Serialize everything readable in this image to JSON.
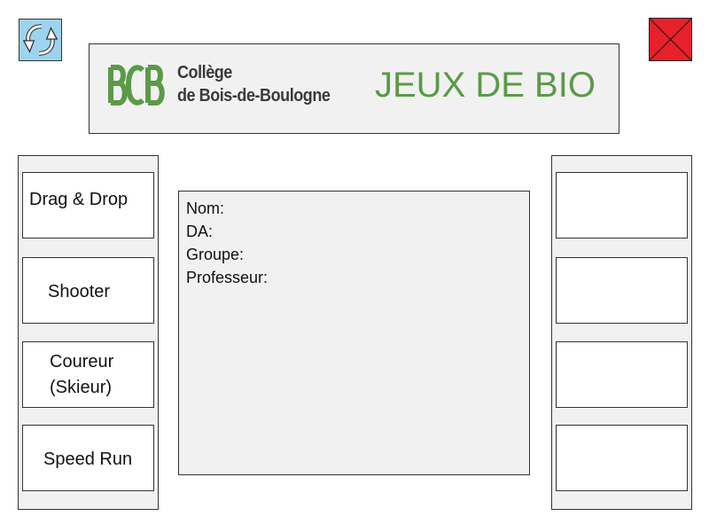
{
  "toolbar": {
    "refresh_icon": "refresh-icon",
    "close_icon": "close-icon"
  },
  "banner": {
    "college_line1": "Collège",
    "college_line2": "de Bois-de-Boulogne",
    "title": "JEUX DE BIO",
    "logo_mark_text": "BCB",
    "brand_color": "#5b9a47"
  },
  "left_menu": {
    "items": [
      {
        "label": "Drag & Drop"
      },
      {
        "label": "Shooter"
      },
      {
        "label_line1": "Coureur",
        "label_line2": "(Skieur)"
      },
      {
        "label": "Speed Run"
      }
    ]
  },
  "info_panel": {
    "nom_label": "Nom:",
    "da_label": "DA:",
    "groupe_label": "Groupe:",
    "professeur_label": "Professeur:"
  },
  "right_menu": {
    "items": [
      "",
      "",
      "",
      ""
    ]
  },
  "colors": {
    "close_red": "#e8202a",
    "refresh_blue": "#9dd3ee",
    "panel_gray": "#f1f1f1"
  }
}
